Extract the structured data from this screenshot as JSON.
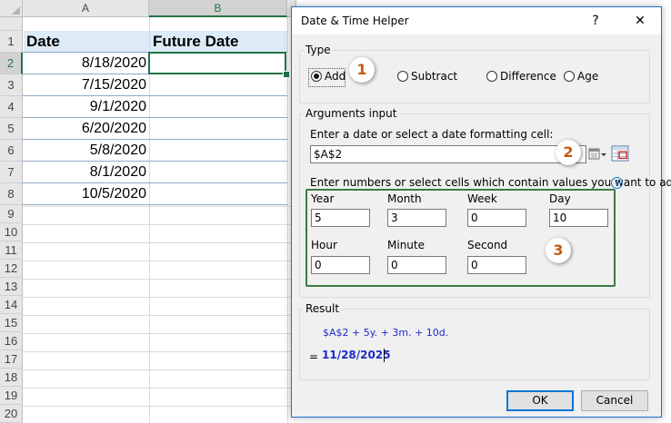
{
  "spreadsheet": {
    "columns": [
      "A",
      "B"
    ],
    "rows": [
      "1",
      "2",
      "3",
      "4",
      "5",
      "6",
      "7",
      "8",
      "9",
      "10",
      "11",
      "12",
      "13",
      "14",
      "15",
      "16",
      "17",
      "18",
      "19",
      "20"
    ],
    "header_cells": {
      "a": "Date",
      "b": "Future Date"
    },
    "dates": [
      "8/18/2020",
      "7/15/2020",
      "9/1/2020",
      "6/20/2020",
      "5/8/2020",
      "8/1/2020",
      "10/5/2020"
    ]
  },
  "dialog": {
    "title": "Date & Time Helper",
    "help_label": "?",
    "close_label": "✕",
    "type_section": {
      "legend": "Type",
      "options": [
        {
          "label": "Add",
          "selected": true
        },
        {
          "label": "Subtract",
          "selected": false
        },
        {
          "label": "Difference",
          "selected": false
        },
        {
          "label": "Age",
          "selected": false
        }
      ]
    },
    "arguments": {
      "legend": "Arguments input",
      "date_prompt": "Enter a date or select a date formatting cell:",
      "date_value": "$A$2",
      "values_prompt": "Enter numbers or select cells which contain values you want to add:",
      "info_icon": "i",
      "fields": {
        "year": {
          "label": "Year",
          "value": "5"
        },
        "month": {
          "label": "Month",
          "value": "3"
        },
        "week": {
          "label": "Week",
          "value": "0"
        },
        "day": {
          "label": "Day",
          "value": "10"
        },
        "hour": {
          "label": "Hour",
          "value": "0"
        },
        "minute": {
          "label": "Minute",
          "value": "0"
        },
        "second": {
          "label": "Second",
          "value": "0"
        }
      }
    },
    "result": {
      "legend": "Result",
      "formula": "$A$2 + 5y. + 3m. + 10d.",
      "equals": "=",
      "value": "11/28/2025"
    },
    "ok_label": "OK",
    "cancel_label": "Cancel"
  },
  "badges": [
    "1",
    "2",
    "3"
  ],
  "colors": {
    "accent_green": "#217346",
    "header_fill": "#ddebf7",
    "result_blue": "#1c2bc8",
    "badge_orange": "#c55a11",
    "highlight_box": "#3a7d44"
  },
  "icons": {
    "calendar_dropdown": "calendar-dropdown-icon",
    "cell_range": "cell-range-select-icon",
    "info": "info-icon"
  }
}
